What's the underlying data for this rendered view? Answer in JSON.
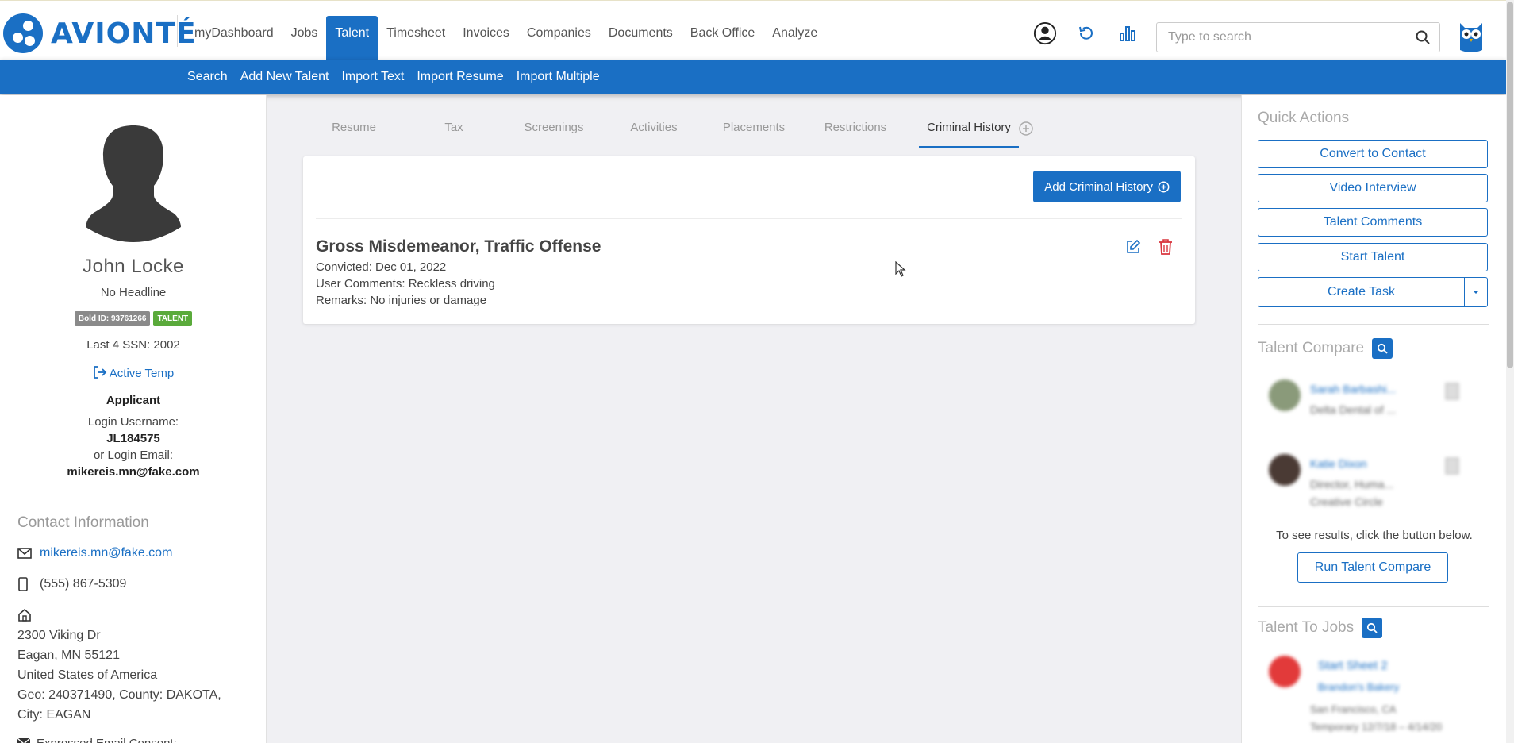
{
  "brand": {
    "name": "AVIONTÉ",
    "color": "#1a6fc4"
  },
  "main_nav": [
    {
      "label": "myDashboard"
    },
    {
      "label": "Jobs"
    },
    {
      "label": "Talent",
      "active": true
    },
    {
      "label": "Timesheet"
    },
    {
      "label": "Invoices"
    },
    {
      "label": "Companies"
    },
    {
      "label": "Documents"
    },
    {
      "label": "Back Office"
    },
    {
      "label": "Analyze"
    }
  ],
  "header_icons": [
    "user-circle-icon",
    "history-icon",
    "bar-chart-icon",
    "owl-logo-icon"
  ],
  "search": {
    "placeholder": "Type to search",
    "value": ""
  },
  "sub_nav": [
    {
      "label": "Search"
    },
    {
      "label": "Add New Talent"
    },
    {
      "label": "Import Text"
    },
    {
      "label": "Import Resume"
    },
    {
      "label": "Import Multiple"
    }
  ],
  "profile": {
    "name": "John Locke",
    "headline": "No Headline",
    "bold_id": "Bold ID: 93761266",
    "type_badge": "TALENT",
    "ssn": "Last 4 SSN: 2002",
    "status": "Active Temp",
    "role": "Applicant",
    "login_username_label": "Login Username:",
    "login_username": "JL184575",
    "login_email_label": "or Login Email:",
    "login_email": "mikereis.mn@fake.com"
  },
  "contact": {
    "title": "Contact Information",
    "email": "mikereis.mn@fake.com",
    "phone": "(555) 867-5309",
    "address": [
      "2300 Viking Dr",
      "Eagan, MN 55121",
      "United States of America",
      "Geo: 240371490, County: DAKOTA,",
      "City: EAGAN"
    ],
    "consent": "Expressed Email Consent:"
  },
  "tabs": [
    {
      "label": "Resume"
    },
    {
      "label": "Tax"
    },
    {
      "label": "Screenings"
    },
    {
      "label": "Activities"
    },
    {
      "label": "Placements"
    },
    {
      "label": "Restrictions"
    },
    {
      "label": "Criminal History",
      "active": true
    }
  ],
  "criminal_history": {
    "add_button": "Add Criminal History",
    "record": {
      "title": "Gross Misdemeanor, Traffic Offense",
      "convicted": "Convicted: Dec 01, 2022",
      "comments": "User Comments: Reckless driving",
      "remarks": "Remarks: No injuries or damage"
    }
  },
  "quick_actions": {
    "title": "Quick Actions",
    "buttons": [
      "Convert to Contact",
      "Video Interview",
      "Talent Comments",
      "Start Talent"
    ],
    "split_button": "Create Task"
  },
  "talent_compare": {
    "title": "Talent Compare",
    "items": [
      {
        "name": "Sarah Barbashi...",
        "sub": [
          "Delta Dental of ..."
        ]
      },
      {
        "name": "Katie Dixon",
        "sub": [
          "Director, Huma...",
          "Creative Circle"
        ]
      }
    ],
    "hint": "To see results, click the button below.",
    "run_button": "Run Talent Compare"
  },
  "talent_to_jobs": {
    "title": "Talent To Jobs",
    "item": {
      "name": "Start Sheet 2",
      "company": "Brandon's Bakery",
      "location": "San Francisco, CA",
      "type": "Temporary 12/7/18 – 4/14/20"
    }
  }
}
